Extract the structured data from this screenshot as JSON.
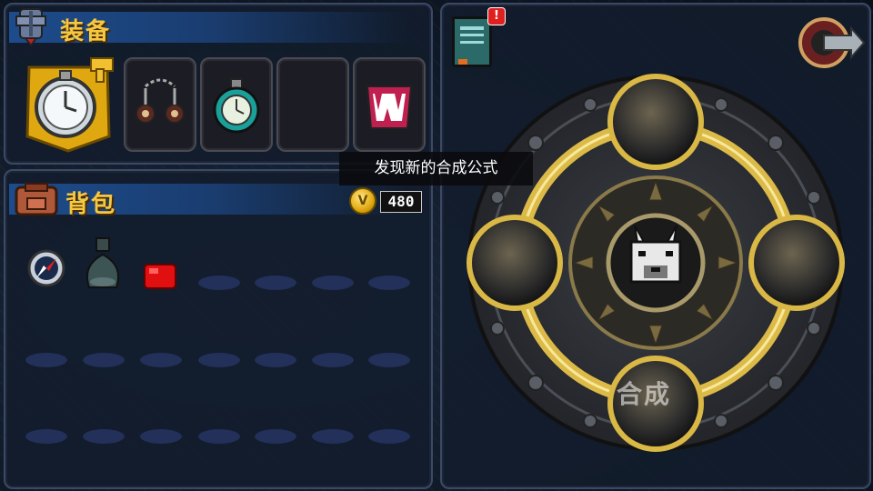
{
  "equipment": {
    "title": "装备",
    "slots": [
      {
        "item": "stopwatch-charm"
      },
      {
        "item": "spiked-chain"
      },
      {
        "item": "teal-pocket-watch"
      },
      {
        "item": "empty"
      },
      {
        "item": "fanged-maw"
      }
    ]
  },
  "backpack": {
    "title": "背包",
    "gold": "480",
    "items": [
      "compass",
      "dark-potion",
      "red-gem"
    ],
    "empty_slot_count": 18
  },
  "tooltip": "发现新的合成公式",
  "crafting": {
    "center_item": "wolf-head",
    "craft_button_label": "合成",
    "notification_badge": "!"
  },
  "colors": {
    "title_gold": "#f5c842",
    "header_blue": "#1d4c8c",
    "ring_gold": "#d9b845"
  }
}
